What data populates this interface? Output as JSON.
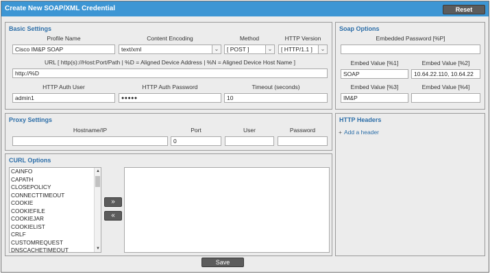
{
  "header": {
    "title": "Create New SOAP/XML Credential",
    "reset_label": "Reset"
  },
  "basic": {
    "title": "Basic Settings",
    "profile_name_label": "Profile Name",
    "profile_name_value": "Cisco IM&P SOAP",
    "content_encoding_label": "Content Encoding",
    "content_encoding_value": "text/xml",
    "method_label": "Method",
    "method_value": "[ POST ]",
    "http_version_label": "HTTP Version",
    "http_version_value": "[ HTTP/1.1 ]",
    "url_label": "URL [ http(s)://Host:Port/Path | %D = Aligned Device Address | %N = Aligned Device Host Name ]",
    "url_value": "http://%D",
    "auth_user_label": "HTTP Auth User",
    "auth_user_value": "admin1",
    "auth_password_label": "HTTP Auth Password",
    "auth_password_value": "●●●●●",
    "timeout_label": "Timeout (seconds)",
    "timeout_value": "10"
  },
  "soap": {
    "title": "Soap Options",
    "embedded_password_label": "Embedded Password [%P]",
    "embedded_password_value": "",
    "embed1_label": "Embed Value [%1]",
    "embed1_value": "SOAP",
    "embed2_label": "Embed Value [%2]",
    "embed2_value": "10.64.22.110, 10.64.22",
    "embed3_label": "Embed Value [%3]",
    "embed3_value": "IM&P",
    "embed4_label": "Embed Value [%4]",
    "embed4_value": ""
  },
  "proxy": {
    "title": "Proxy Settings",
    "hostname_label": "Hostname/IP",
    "hostname_value": "",
    "port_label": "Port",
    "port_value": "0",
    "user_label": "User",
    "user_value": "",
    "password_label": "Password",
    "password_value": ""
  },
  "headers": {
    "title": "HTTP Headers",
    "add_icon": "plus-icon",
    "add_label": "Add a header"
  },
  "curl": {
    "title": "CURL Options",
    "options": [
      "CAINFO",
      "CAPATH",
      "CLOSEPOLICY",
      "CONNECTTIMEOUT",
      "COOKIE",
      "COOKIEFILE",
      "COOKIEJAR",
      "COOKIELIST",
      "CRLF",
      "CUSTOMREQUEST",
      "DNSCACHETIMEOUT"
    ],
    "add_label": "»",
    "remove_label": "«"
  },
  "footer": {
    "save_label": "Save"
  },
  "colors": {
    "titlebar": "#3d96d4",
    "section_title": "#2c6ea8",
    "button": "#5c5c5c"
  }
}
